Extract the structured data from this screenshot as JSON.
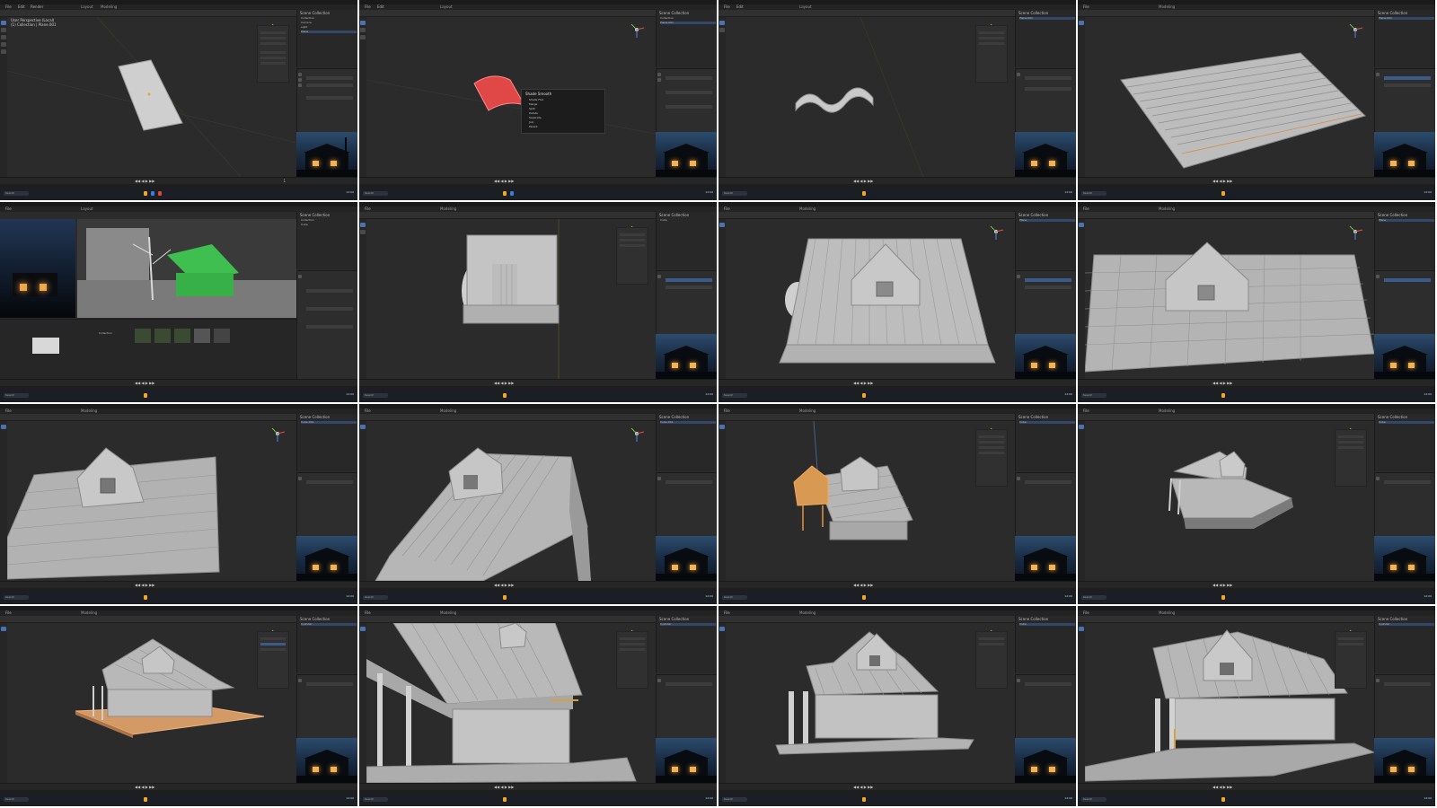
{
  "app": {
    "menus": [
      "File",
      "Edit",
      "Render",
      "Window",
      "Help"
    ],
    "workspaces": [
      "Layout",
      "Modeling",
      "Sculpting",
      "UV Editing",
      "Texture Paint",
      "Shading"
    ],
    "viewport_info": [
      "User Perspective (Local)",
      "(1) Collection | Plane.001"
    ],
    "outliner_title": "Scene Collection",
    "outliner_items": [
      "Collection",
      "Camera",
      "Light",
      "Plane",
      "Plane.001",
      "Cube",
      "Cube.001",
      "Cylinder"
    ],
    "timeline_controls": "◀◀  ◀  ▶  ▶▶",
    "frame": "1",
    "taskbar": {
      "search": "Search",
      "clock": "12:00"
    }
  },
  "tiles": [
    {
      "id": 1,
      "subject": "flat plane"
    },
    {
      "id": 2,
      "subject": "tile with context menu",
      "popup_title": "Shade Smooth",
      "popup_items": [
        "Shade Flat",
        "Merge",
        "Split",
        "Delete",
        "Separate",
        "Join",
        "Parent"
      ]
    },
    {
      "id": 3,
      "subject": "curved roof tile"
    },
    {
      "id": 4,
      "subject": "tiled roof array"
    },
    {
      "id": 5,
      "subject": "reference scene with grass"
    },
    {
      "id": 6,
      "subject": "house box blockout"
    },
    {
      "id": 7,
      "subject": "roof with dormer"
    },
    {
      "id": 8,
      "subject": "roof with dormer side"
    },
    {
      "id": 9,
      "subject": "roof dormer close"
    },
    {
      "id": 10,
      "subject": "roof dormer steep"
    },
    {
      "id": 11,
      "subject": "roof with orange selection"
    },
    {
      "id": 12,
      "subject": "house from below"
    },
    {
      "id": 13,
      "subject": "house on orange base"
    },
    {
      "id": 14,
      "subject": "house porch closeup"
    },
    {
      "id": 15,
      "subject": "house three-quarter"
    },
    {
      "id": 16,
      "subject": "house with porch base"
    }
  ]
}
